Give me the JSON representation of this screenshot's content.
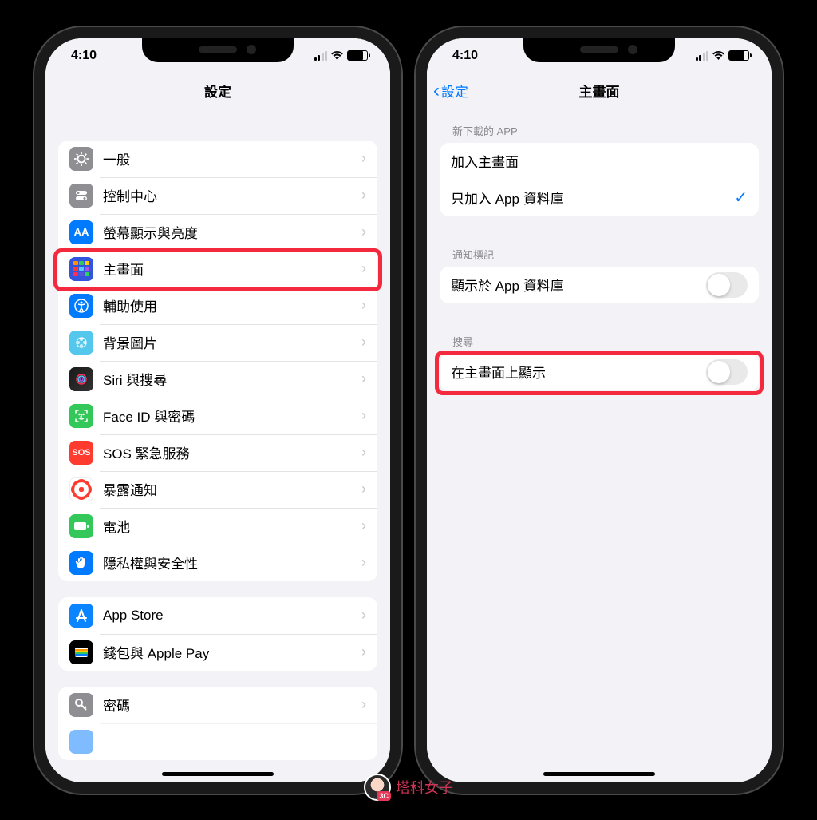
{
  "status": {
    "time": "4:10"
  },
  "left": {
    "title": "設定",
    "groups": [
      {
        "items": [
          {
            "icon": "general",
            "label": "一般"
          },
          {
            "icon": "control",
            "label": "控制中心"
          },
          {
            "icon": "display",
            "label": "螢幕顯示與亮度"
          },
          {
            "icon": "home",
            "label": "主畫面",
            "highlighted": true
          },
          {
            "icon": "access",
            "label": "輔助使用"
          },
          {
            "icon": "wallpaper",
            "label": "背景圖片"
          },
          {
            "icon": "siri",
            "label": "Siri 與搜尋"
          },
          {
            "icon": "faceid",
            "label": "Face ID 與密碼"
          },
          {
            "icon": "sos",
            "label": "SOS 緊急服務"
          },
          {
            "icon": "exposure",
            "label": "暴露通知"
          },
          {
            "icon": "battery",
            "label": "電池"
          },
          {
            "icon": "privacy",
            "label": "隱私權與安全性"
          }
        ]
      },
      {
        "items": [
          {
            "icon": "appstore",
            "label": "App Store"
          },
          {
            "icon": "wallet",
            "label": "錢包與 Apple Pay"
          }
        ]
      },
      {
        "items": [
          {
            "icon": "password",
            "label": "密碼"
          }
        ]
      }
    ]
  },
  "right": {
    "back": "設定",
    "title": "主畫面",
    "section1": {
      "header": "新下載的 APP",
      "opt1": "加入主畫面",
      "opt2": "只加入 App 資料庫"
    },
    "section2": {
      "header": "通知標記",
      "opt": "顯示於 App 資料庫"
    },
    "section3": {
      "header": "搜尋",
      "opt": "在主畫面上顯示"
    }
  },
  "watermark": "塔科女子"
}
